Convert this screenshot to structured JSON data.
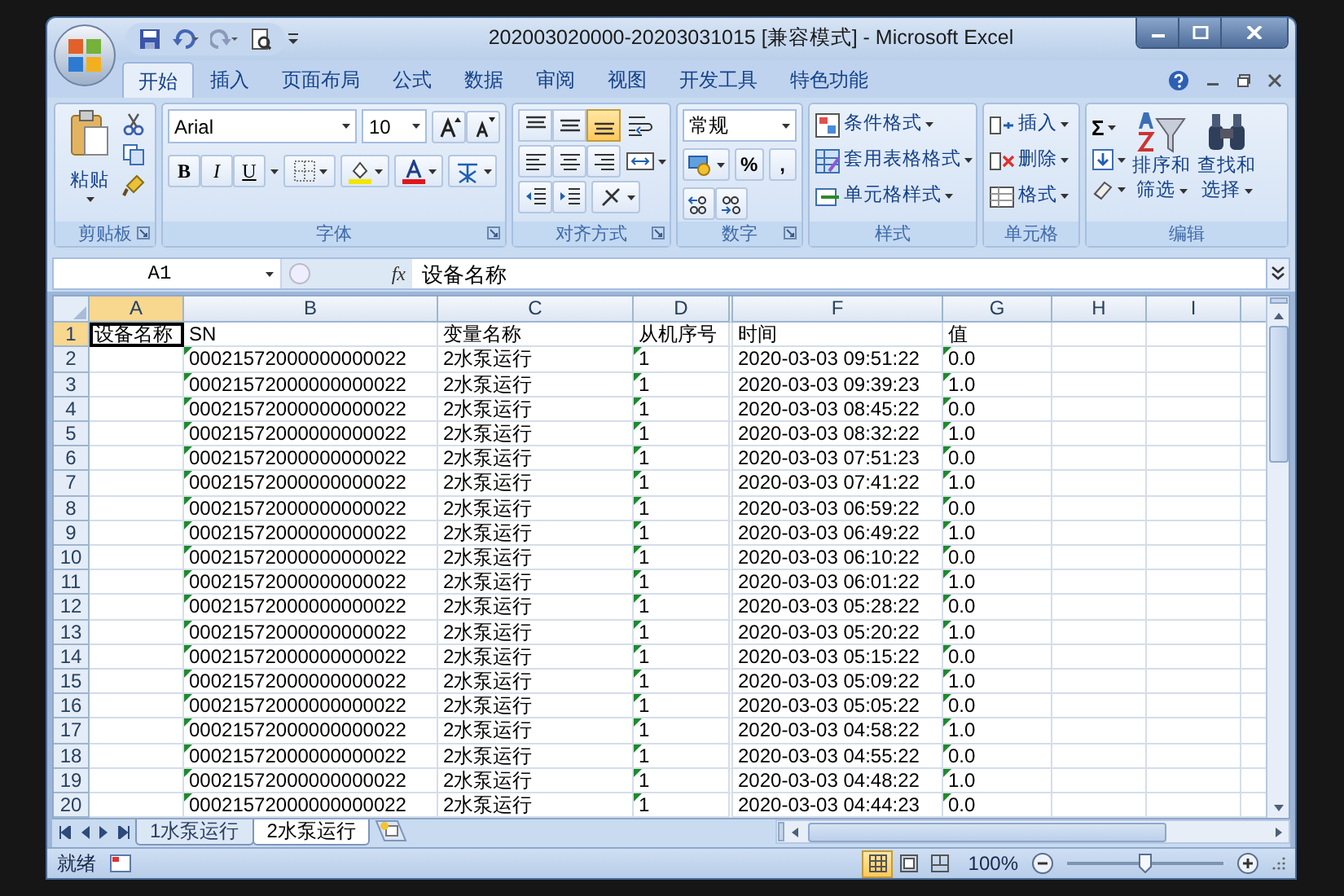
{
  "window": {
    "title": "202003020000-20203031015  [兼容模式] - Microsoft Excel"
  },
  "ribbon_tabs": [
    {
      "label": "开始",
      "selected": true
    },
    {
      "label": "插入",
      "selected": false
    },
    {
      "label": "页面布局",
      "selected": false
    },
    {
      "label": "公式",
      "selected": false
    },
    {
      "label": "数据",
      "selected": false
    },
    {
      "label": "审阅",
      "selected": false
    },
    {
      "label": "视图",
      "selected": false
    },
    {
      "label": "开发工具",
      "selected": false
    },
    {
      "label": "特色功能",
      "selected": false
    }
  ],
  "ribbon_groups": [
    {
      "kind": "clipboard",
      "label": "剪贴板",
      "paste": "粘贴"
    },
    {
      "kind": "font",
      "label": "字体",
      "font_name": "Arial",
      "font_size": "10",
      "style_buttons": [
        "B",
        "I",
        "U"
      ]
    },
    {
      "kind": "alignment",
      "label": "对齐方式",
      "vertical_align": [
        {
          "selected": false
        },
        {
          "selected": false
        },
        {
          "selected": true
        }
      ]
    },
    {
      "kind": "number",
      "label": "数字",
      "format": "常规",
      "symbols": [
        "%",
        ","
      ]
    },
    {
      "kind": "styles",
      "label": "样式",
      "items": [
        "条件格式",
        "套用表格格式",
        "单元格样式"
      ]
    },
    {
      "kind": "cells",
      "label": "单元格",
      "items": [
        "插入",
        "删除",
        "格式"
      ]
    },
    {
      "kind": "editing",
      "label": "编辑",
      "sum": "Σ",
      "sort": [
        "排序和",
        "筛选"
      ],
      "find": [
        "查找和",
        "选择"
      ]
    }
  ],
  "formula_bar": {
    "name_box": "A1",
    "function_label": "fx",
    "content": "设备名称"
  },
  "sheet": {
    "columns": [
      {
        "label": "A",
        "selected": true,
        "marked": false
      },
      {
        "label": "B",
        "selected": false,
        "marked": true
      },
      {
        "label": "C",
        "selected": false,
        "marked": false
      },
      {
        "label": "D",
        "selected": false,
        "marked": true
      },
      {
        "label": "F",
        "selected": false,
        "marked": false
      },
      {
        "label": "G",
        "selected": false,
        "marked": true
      },
      {
        "label": "H",
        "selected": false,
        "marked": false
      },
      {
        "label": "I",
        "selected": false,
        "marked": false
      }
    ],
    "rows": [
      {
        "number": "1",
        "selected": true,
        "flagged": false,
        "cells": [
          "设备名称",
          "SN",
          "变量名称",
          "从机序号",
          "时间",
          "值"
        ]
      },
      {
        "number": "2",
        "selected": false,
        "flagged": true,
        "cells": [
          "",
          "00021572000000000022",
          "2水泵运行",
          "1",
          "2020-03-03 09:51:22",
          "0.0"
        ]
      },
      {
        "number": "3",
        "selected": false,
        "flagged": true,
        "cells": [
          "",
          "00021572000000000022",
          "2水泵运行",
          "1",
          "2020-03-03 09:39:23",
          "1.0"
        ]
      },
      {
        "number": "4",
        "selected": false,
        "flagged": true,
        "cells": [
          "",
          "00021572000000000022",
          "2水泵运行",
          "1",
          "2020-03-03 08:45:22",
          "0.0"
        ]
      },
      {
        "number": "5",
        "selected": false,
        "flagged": true,
        "cells": [
          "",
          "00021572000000000022",
          "2水泵运行",
          "1",
          "2020-03-03 08:32:22",
          "1.0"
        ]
      },
      {
        "number": "6",
        "selected": false,
        "flagged": true,
        "cells": [
          "",
          "00021572000000000022",
          "2水泵运行",
          "1",
          "2020-03-03 07:51:23",
          "0.0"
        ]
      },
      {
        "number": "7",
        "selected": false,
        "flagged": true,
        "cells": [
          "",
          "00021572000000000022",
          "2水泵运行",
          "1",
          "2020-03-03 07:41:22",
          "1.0"
        ]
      },
      {
        "number": "8",
        "selected": false,
        "flagged": true,
        "cells": [
          "",
          "00021572000000000022",
          "2水泵运行",
          "1",
          "2020-03-03 06:59:22",
          "0.0"
        ]
      },
      {
        "number": "9",
        "selected": false,
        "flagged": true,
        "cells": [
          "",
          "00021572000000000022",
          "2水泵运行",
          "1",
          "2020-03-03 06:49:22",
          "1.0"
        ]
      },
      {
        "number": "10",
        "selected": false,
        "flagged": true,
        "cells": [
          "",
          "00021572000000000022",
          "2水泵运行",
          "1",
          "2020-03-03 06:10:22",
          "0.0"
        ]
      },
      {
        "number": "11",
        "selected": false,
        "flagged": true,
        "cells": [
          "",
          "00021572000000000022",
          "2水泵运行",
          "1",
          "2020-03-03 06:01:22",
          "1.0"
        ]
      },
      {
        "number": "12",
        "selected": false,
        "flagged": true,
        "cells": [
          "",
          "00021572000000000022",
          "2水泵运行",
          "1",
          "2020-03-03 05:28:22",
          "0.0"
        ]
      },
      {
        "number": "13",
        "selected": false,
        "flagged": true,
        "cells": [
          "",
          "00021572000000000022",
          "2水泵运行",
          "1",
          "2020-03-03 05:20:22",
          "1.0"
        ]
      },
      {
        "number": "14",
        "selected": false,
        "flagged": true,
        "cells": [
          "",
          "00021572000000000022",
          "2水泵运行",
          "1",
          "2020-03-03 05:15:22",
          "0.0"
        ]
      },
      {
        "number": "15",
        "selected": false,
        "flagged": true,
        "cells": [
          "",
          "00021572000000000022",
          "2水泵运行",
          "1",
          "2020-03-03 05:09:22",
          "1.0"
        ]
      },
      {
        "number": "16",
        "selected": false,
        "flagged": true,
        "cells": [
          "",
          "00021572000000000022",
          "2水泵运行",
          "1",
          "2020-03-03 05:05:22",
          "0.0"
        ]
      },
      {
        "number": "17",
        "selected": false,
        "flagged": true,
        "cells": [
          "",
          "00021572000000000022",
          "2水泵运行",
          "1",
          "2020-03-03 04:58:22",
          "1.0"
        ]
      },
      {
        "number": "18",
        "selected": false,
        "flagged": true,
        "cells": [
          "",
          "00021572000000000022",
          "2水泵运行",
          "1",
          "2020-03-03 04:55:22",
          "0.0"
        ]
      },
      {
        "number": "19",
        "selected": false,
        "flagged": true,
        "cells": [
          "",
          "00021572000000000022",
          "2水泵运行",
          "1",
          "2020-03-03 04:48:22",
          "1.0"
        ]
      },
      {
        "number": "20",
        "selected": false,
        "flagged": true,
        "cells": [
          "",
          "00021572000000000022",
          "2水泵运行",
          "1",
          "2020-03-03 04:44:23",
          "0.0"
        ]
      }
    ]
  },
  "sheet_tabs": [
    {
      "label": "1水泵运行",
      "selected": false
    },
    {
      "label": "2水泵运行",
      "selected": true
    }
  ],
  "status_bar": {
    "status": "就绪",
    "views": [
      {
        "selected": true
      },
      {
        "selected": false
      },
      {
        "selected": false
      }
    ],
    "zoom": "100%",
    "zoom_slider": {
      "level": 0.5
    }
  }
}
